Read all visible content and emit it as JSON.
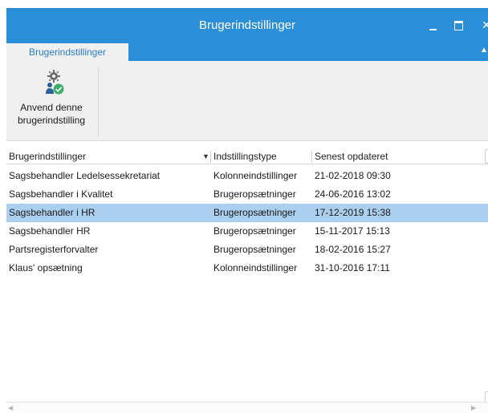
{
  "window": {
    "title": "Brugerindstillinger",
    "minimize_glyph": "",
    "maximize_glyph": "",
    "close_glyph": "✕"
  },
  "ribbon": {
    "tab_label": "Brugerindstillinger",
    "apply_button": {
      "line1": "Anvend denne",
      "line2": "brugerindstilling",
      "icon": "user-settings-check-icon"
    }
  },
  "grid": {
    "columns": [
      "Brugerindstillinger",
      "Indstillingstype",
      "Senest opdateret"
    ],
    "rows": [
      {
        "name": "Sagsbehandler Ledelsessekretariat",
        "type": "Kolonneindstillinger",
        "updated": "21-02-2018 09:30"
      },
      {
        "name": "Sagsbehandler i Kvalitet",
        "type": "Brugeropsætninger",
        "updated": "24-06-2016 13:02"
      },
      {
        "name": "Sagsbehandler i HR",
        "type": "Brugeropsætninger",
        "updated": "17-12-2019 15:38"
      },
      {
        "name": "Sagsbehandler HR",
        "type": "Brugeropsætninger",
        "updated": "15-11-2017 15:13"
      },
      {
        "name": "Partsregisterforvalter",
        "type": "Brugeropsætninger",
        "updated": "18-02-2016 15:27"
      },
      {
        "name": "Klaus' opsætning",
        "type": "Kolonneindstillinger",
        "updated": "31-10-2016 17:11"
      }
    ],
    "selected_row": 2
  },
  "colors": {
    "accent": "#2b8ed8",
    "selection": "#abcfee",
    "ribbon_bg": "#f0f0f0"
  }
}
